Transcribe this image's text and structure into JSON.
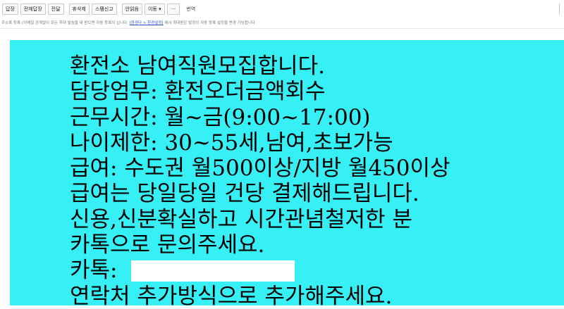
{
  "toolbar": {
    "reply": "답장",
    "reply_all": "전체답장",
    "forward": "전달",
    "delete": "휴삭제",
    "spam": "스팸신고",
    "read": "안읽음",
    "move": "이동",
    "more": "···",
    "translate": "번역"
  },
  "notice": {
    "text": "주소록 등록 (이메일 관계없이 모든 추대 발송을 내 받으면 자동 등록되 십니다.",
    "link": "[환경다 > 환경설정]",
    "text_after": "에서 최대받은 발정의 자동 등록 설정을 변경 가능합니다."
  },
  "message": {
    "lines": [
      "환전소 남여직원모집합니다.",
      "담당엄무: 환전오더금액회수",
      "근무시간: 월~금(9:00~17:00)",
      "나이제한: 30~55세,남여,초보가능",
      "급여: 수도권 월500이상/지방 월450이상",
      "급여는 당일당일 건당 결제해드립니다.",
      "신용,신분확실하고 시간관념철저한 분",
      "카톡으로 문의주세요.",
      "카톡:",
      "연락처 추가방식으로 추가해주세요."
    ],
    "background": "#36f0f6"
  }
}
